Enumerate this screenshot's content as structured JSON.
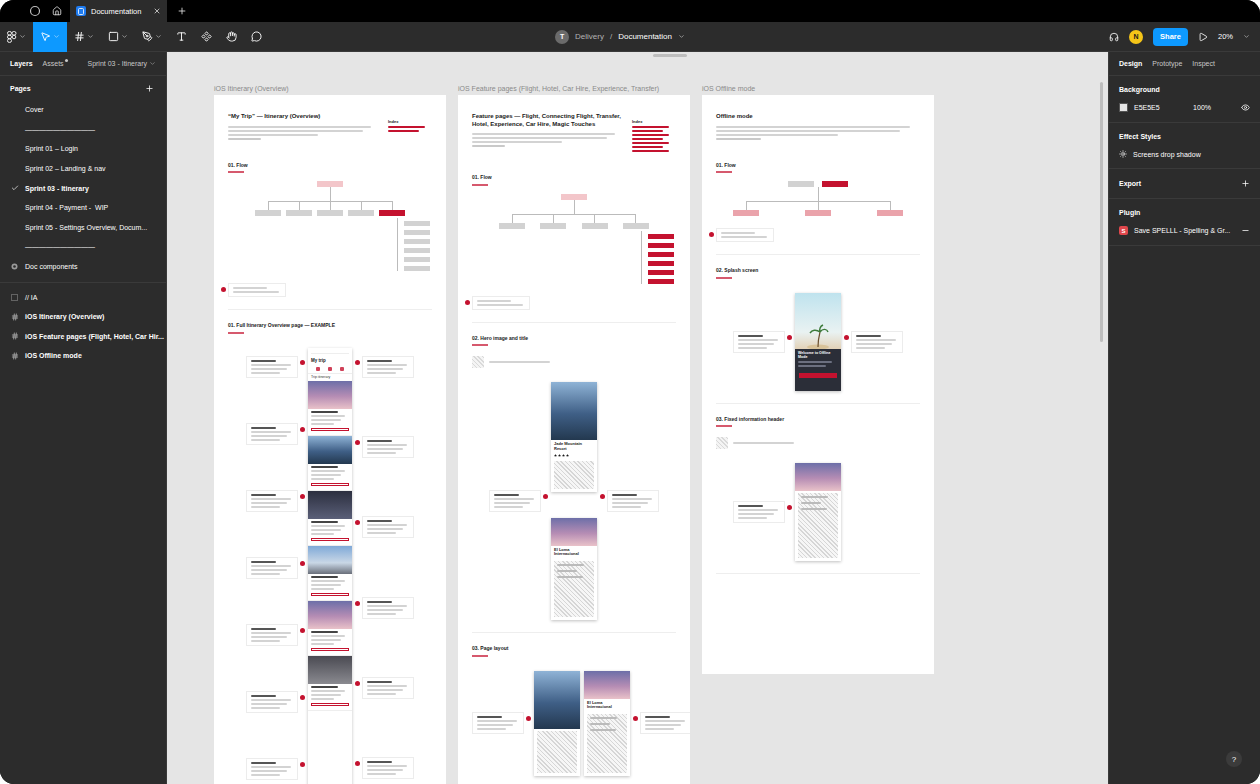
{
  "browser_tabs": [
    {
      "label": "Documentation",
      "selected": true
    }
  ],
  "toolbar": {
    "tools": [
      {
        "selected": true
      },
      {
        "selected": false
      },
      {
        "selected": false
      },
      {
        "selected": false
      },
      {
        "selected": false
      },
      {
        "selected": false
      },
      {
        "selected": false
      },
      {
        "selected": false
      }
    ],
    "team_avatar": "T",
    "project": "Delivery",
    "separator": "/",
    "file": "Documentation",
    "user_avatar": "N",
    "share": "Share",
    "zoom": "20%"
  },
  "left_panel": {
    "tabs": [
      {
        "label": "Layers",
        "selected": true,
        "unsaved": false
      },
      {
        "label": "Assets",
        "selected": false,
        "unsaved": true
      }
    ],
    "page_selector": "Sprint 03 - Itinerary",
    "pages_title": "Pages",
    "pages": [
      {
        "label": "Cover",
        "selected": false,
        "kind": "page"
      },
      {
        "label": "——————————",
        "selected": false,
        "kind": "page"
      },
      {
        "label": "Sprint 01 – Login",
        "selected": false,
        "kind": "page"
      },
      {
        "label": "Sprint 02 – Landing & nav",
        "selected": false,
        "kind": "page"
      },
      {
        "label": "Sprint 03 - Itinerary",
        "selected": true,
        "kind": "page"
      },
      {
        "label": "Sprint 04 - Payment -  WIP",
        "selected": false,
        "kind": "page"
      },
      {
        "label": "Sprint 05 - Settings Overview, Docum...",
        "selected": false,
        "kind": "page"
      },
      {
        "label": "——————————",
        "selected": false,
        "kind": "page"
      },
      {
        "label": "Doc components",
        "selected": false,
        "kind": "components"
      }
    ],
    "layers": [
      {
        "label": "// IA",
        "kind": "section"
      },
      {
        "label": "iOS Itinerary (Overview)",
        "kind": "frame"
      },
      {
        "label": "iOS Feature pages (Flight, Hotel, Car Hir...",
        "kind": "frame"
      },
      {
        "label": "iOS Offline mode",
        "kind": "frame"
      }
    ]
  },
  "right_panel": {
    "tabs": [
      {
        "label": "Design",
        "selected": true
      },
      {
        "label": "Prototype",
        "selected": false
      },
      {
        "label": "Inspect",
        "selected": false
      }
    ],
    "background": {
      "title": "Background",
      "hex": "E5E5E5",
      "opacity": "100%",
      "color": "#e5e5e5",
      "visible": true
    },
    "effect_styles": {
      "title": "Effect Styles",
      "items": [
        "Screens drop shadow"
      ]
    },
    "export": {
      "title": "Export"
    },
    "plugins": {
      "title": "Plugin",
      "items": [
        {
          "badge": "S",
          "label": "Save SPELLL - Spelling & Gr..."
        }
      ]
    },
    "help": "?"
  },
  "canvas": {
    "frames": [
      {
        "label": "iOS Itinerary (Overview)",
        "title": "“My Trip” — Itinerary (Overview)",
        "index_title": "Index",
        "sections": [
          {
            "kind": "flow",
            "heading": "01. Flow",
            "flow": {
              "roots": [
                {
                  "color": "#f3c6ca"
                }
              ],
              "children": [
                {
                  "color": "#d2d2d2",
                  "children": []
                },
                {
                  "color": "#d2d2d2",
                  "children": []
                },
                {
                  "color": "#d2d2d2",
                  "children": []
                },
                {
                  "color": "#d2d2d2",
                  "children": []
                },
                {
                  "color": "#c4122f",
                  "children": [
                    {
                      "color": "#d2d2d2"
                    },
                    {
                      "color": "#d2d2d2"
                    },
                    {
                      "color": "#d2d2d2"
                    },
                    {
                      "color": "#d2d2d2"
                    },
                    {
                      "color": "#d2d2d2"
                    },
                    {
                      "color": "#d2d2d2"
                    }
                  ]
                }
              ]
            }
          },
          {
            "kind": "screens",
            "heading": "01. Full Itinerary Overview page — EXAMPLE",
            "legend": false,
            "phones": [
              {
                "kind": "itinerary",
                "title": "My trip",
                "subtitle": "Trip itinerary",
                "cards": [
                  {
                    "kind": "flight"
                  },
                  {
                    "kind": "hotel"
                  },
                  {
                    "kind": "transfer"
                  },
                  {
                    "kind": "experience"
                  },
                  {
                    "kind": "flight"
                  },
                  {
                    "kind": "car"
                  }
                ]
              }
            ]
          }
        ]
      },
      {
        "label": "iOS Feature pages (Flight, Hotel, Car Hire, Experience, Transfer)",
        "title": "Feature pages — Flight, Connecting Flight, Transfer, Hotel, Experience, Car Hire, Magic Touches",
        "index_title": "Index",
        "sections": [
          {
            "kind": "flow",
            "heading": "01. Flow",
            "flow": {
              "roots": [
                {
                  "color": "#f3c6ca"
                }
              ],
              "children": [
                {
                  "color": "#d2d2d2",
                  "children": []
                },
                {
                  "color": "#d2d2d2",
                  "children": []
                },
                {
                  "color": "#d2d2d2",
                  "children": []
                },
                {
                  "color": "#d2d2d2",
                  "children": [
                    {
                      "color": "#c4122f"
                    },
                    {
                      "color": "#c4122f"
                    },
                    {
                      "color": "#c4122f"
                    },
                    {
                      "color": "#c4122f"
                    },
                    {
                      "color": "#c4122f"
                    },
                    {
                      "color": "#c4122f"
                    }
                  ]
                }
              ]
            }
          },
          {
            "kind": "screens",
            "heading": "02. Hero image and title",
            "legend": true,
            "phones": [
              {
                "kind": "hotel",
                "title": "Jade Mountain Resort",
                "stars": 4
              },
              {
                "kind": "flight",
                "title": "El Loma Internacional"
              }
            ]
          },
          {
            "kind": "gallery",
            "heading": "03. Page layout",
            "legend": false,
            "phones": [
              {
                "kind": "hotel",
                "title": "",
                "stars": 0
              },
              {
                "kind": "flight",
                "title": "El Loma Internacional"
              }
            ]
          }
        ]
      },
      {
        "label": "iOS Offline mode",
        "title": "Offline mode",
        "index_title": "",
        "sections": [
          {
            "kind": "flow",
            "heading": "01. Flow",
            "flow": {
              "roots": [
                {
                  "color": "#d2d2d2"
                },
                {
                  "color": "#c4122f"
                }
              ],
              "children": [
                {
                  "color": "#eaa3ab",
                  "children": []
                },
                {
                  "color": "#eaa3ab",
                  "children": []
                },
                {
                  "color": "#eaa3ab",
                  "children": []
                }
              ]
            }
          },
          {
            "kind": "screens",
            "heading": "02. Splash screen",
            "legend": false,
            "phones": [
              {
                "kind": "splash",
                "title": "Welcome to Offline Mode"
              }
            ]
          },
          {
            "kind": "screens",
            "heading": "03. Fixed information header",
            "legend": true,
            "phones": [
              {
                "kind": "flight",
                "title": ""
              }
            ]
          }
        ]
      }
    ]
  }
}
